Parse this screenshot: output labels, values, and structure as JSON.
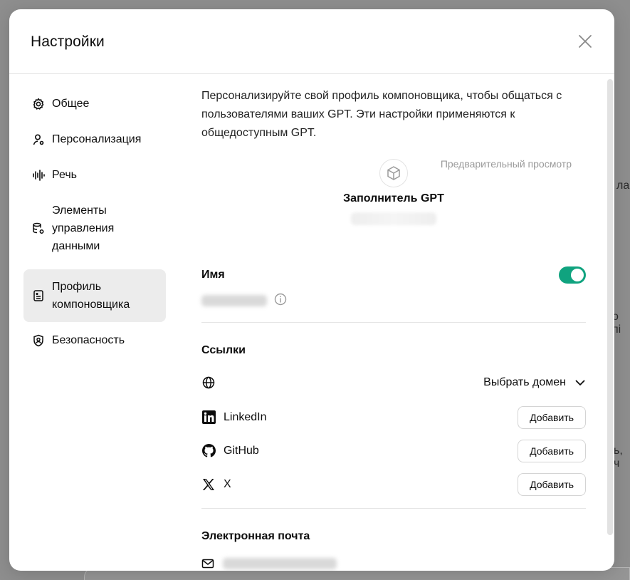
{
  "background": {
    "frag1": "ла",
    "frag2": "о пі",
    "frag3": "ь, ч"
  },
  "modal": {
    "title": "Настройки",
    "close_icon": "close-icon"
  },
  "sidebar": {
    "items": [
      {
        "icon": "gear-icon",
        "label": "Общее"
      },
      {
        "icon": "person-icon",
        "label": "Персонализация"
      },
      {
        "icon": "waveform-icon",
        "label": "Речь"
      },
      {
        "icon": "database-gear-icon",
        "label": "Элементы управления данными"
      },
      {
        "icon": "id-card-icon",
        "label": "Профиль компоновщика",
        "active": true
      },
      {
        "icon": "shield-icon",
        "label": "Безопасность"
      }
    ]
  },
  "content": {
    "intro": "Персонализируйте свой профиль компоновщика, чтобы общаться с пользователями ваших GPT. Эти настройки применяются к общедоступным GPT.",
    "preview": {
      "label": "Предварительный просмотр",
      "name": "Заполнитель GPT"
    },
    "name_section": {
      "title": "Имя",
      "toggle_on": true
    },
    "links_section": {
      "title": "Ссылки",
      "domain_select": "Выбрать домен",
      "items": [
        {
          "icon": "linkedin-icon",
          "label": "LinkedIn",
          "button": "Добавить"
        },
        {
          "icon": "github-icon",
          "label": "GitHub",
          "button": "Добавить"
        },
        {
          "icon": "x-icon",
          "label": "X",
          "button": "Добавить"
        }
      ]
    },
    "email_section": {
      "title": "Электронная почта"
    }
  },
  "colors": {
    "accent": "#10a37f",
    "active_nav": "#ececec"
  }
}
